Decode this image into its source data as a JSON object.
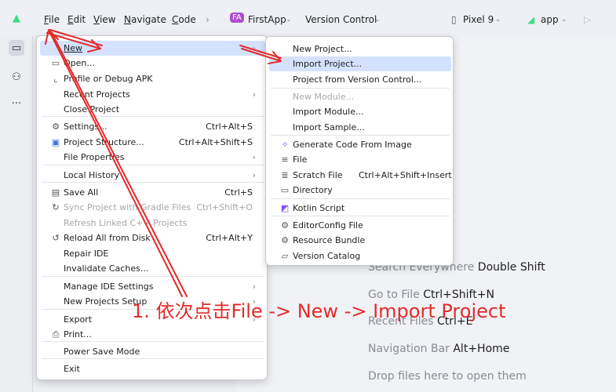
{
  "titlebar": {
    "menus": [
      "File",
      "Edit",
      "View",
      "Navigate",
      "Code"
    ],
    "menu_mnemonics": [
      "F",
      "E",
      "V",
      "N",
      "C"
    ],
    "project_badge": "FA",
    "project_name": "FirstApp",
    "vcs": "Version Control",
    "device": "Pixel 9",
    "run_config": "app"
  },
  "file_menu": {
    "items": [
      {
        "label": "New",
        "shortcut": "",
        "submenu": true,
        "highlighted": true,
        "disabled": false,
        "icon": ""
      },
      {
        "label": "Open...",
        "shortcut": "",
        "submenu": false,
        "disabled": false,
        "icon": "folder-icon"
      },
      {
        "label": "Profile or Debug APK",
        "shortcut": "",
        "submenu": false,
        "disabled": false,
        "icon": "profile-icon"
      },
      {
        "label": "Recent Projects",
        "shortcut": "",
        "submenu": true,
        "disabled": false,
        "icon": ""
      },
      {
        "label": "Close Project",
        "shortcut": "",
        "submenu": false,
        "disabled": false,
        "icon": ""
      },
      {
        "label": "Settings...",
        "shortcut": "Ctrl+Alt+S",
        "submenu": false,
        "disabled": false,
        "icon": "gear-icon"
      },
      {
        "label": "Project Structure...",
        "shortcut": "Ctrl+Alt+Shift+S",
        "submenu": false,
        "disabled": false,
        "icon": "project-structure-icon"
      },
      {
        "label": "File Properties",
        "shortcut": "",
        "submenu": true,
        "disabled": false,
        "icon": ""
      },
      {
        "label": "Local History",
        "shortcut": "",
        "submenu": true,
        "disabled": false,
        "icon": ""
      },
      {
        "label": "Save All",
        "shortcut": "Ctrl+S",
        "submenu": false,
        "disabled": false,
        "icon": "save-icon"
      },
      {
        "label": "Sync Project with Gradle Files",
        "shortcut": "Ctrl+Shift+O",
        "submenu": false,
        "disabled": true,
        "icon": "sync-icon"
      },
      {
        "label": "Refresh Linked C++ Projects",
        "shortcut": "",
        "submenu": false,
        "disabled": true,
        "icon": ""
      },
      {
        "label": "Reload All from Disk",
        "shortcut": "Ctrl+Alt+Y",
        "submenu": false,
        "disabled": false,
        "icon": "reload-icon"
      },
      {
        "label": "Repair IDE",
        "shortcut": "",
        "submenu": false,
        "disabled": false,
        "icon": ""
      },
      {
        "label": "Invalidate Caches...",
        "shortcut": "",
        "submenu": false,
        "disabled": false,
        "icon": ""
      },
      {
        "label": "Manage IDE Settings",
        "shortcut": "",
        "submenu": true,
        "disabled": false,
        "icon": ""
      },
      {
        "label": "New Projects Setup",
        "shortcut": "",
        "submenu": true,
        "disabled": false,
        "icon": ""
      },
      {
        "label": "Export",
        "shortcut": "",
        "submenu": true,
        "disabled": false,
        "icon": ""
      },
      {
        "label": "Print...",
        "shortcut": "",
        "submenu": false,
        "disabled": false,
        "icon": "print-icon"
      },
      {
        "label": "Power Save Mode",
        "shortcut": "",
        "submenu": false,
        "disabled": false,
        "icon": ""
      },
      {
        "label": "Exit",
        "shortcut": "",
        "submenu": false,
        "disabled": false,
        "icon": ""
      }
    ]
  },
  "new_submenu": {
    "items": [
      {
        "label": "New Project...",
        "shortcut": "",
        "highlighted": false,
        "disabled": false,
        "icon": ""
      },
      {
        "label": "Import Project...",
        "shortcut": "",
        "highlighted": true,
        "disabled": false,
        "icon": ""
      },
      {
        "label": "Project from Version Control...",
        "shortcut": "",
        "highlighted": false,
        "disabled": false,
        "icon": ""
      },
      {
        "label": "New Module...",
        "shortcut": "",
        "highlighted": false,
        "disabled": true,
        "icon": ""
      },
      {
        "label": "Import Module...",
        "shortcut": "",
        "highlighted": false,
        "disabled": false,
        "icon": ""
      },
      {
        "label": "Import Sample...",
        "shortcut": "",
        "highlighted": false,
        "disabled": false,
        "icon": ""
      },
      {
        "label": "Generate Code From Image",
        "shortcut": "",
        "highlighted": false,
        "disabled": false,
        "icon": "sparkle-icon"
      },
      {
        "label": "File",
        "shortcut": "",
        "highlighted": false,
        "disabled": false,
        "icon": "file-lines-icon"
      },
      {
        "label": "Scratch File",
        "shortcut": "Ctrl+Alt+Shift+Insert",
        "highlighted": false,
        "disabled": false,
        "icon": "scratch-file-icon"
      },
      {
        "label": "Directory",
        "shortcut": "",
        "highlighted": false,
        "disabled": false,
        "icon": "folder-icon"
      },
      {
        "label": "Kotlin Script",
        "shortcut": "",
        "highlighted": false,
        "disabled": false,
        "icon": "kotlin-icon"
      },
      {
        "label": "EditorConfig File",
        "shortcut": "",
        "highlighted": false,
        "disabled": false,
        "icon": "gear-icon"
      },
      {
        "label": "Resource Bundle",
        "shortcut": "",
        "highlighted": false,
        "disabled": false,
        "icon": "gear-icon"
      },
      {
        "label": "Version Catalog",
        "shortcut": "",
        "highlighted": false,
        "disabled": false,
        "icon": "catalog-icon"
      }
    ]
  },
  "editor_hints": [
    {
      "text": "Search Everywhere",
      "key": "Double Shift"
    },
    {
      "text": "Go to File",
      "key": "Ctrl+Shift+N"
    },
    {
      "text": "Recent Files",
      "key": "Ctrl+E"
    },
    {
      "text": "Navigation Bar",
      "key": "Alt+Home"
    },
    {
      "text": "Drop files here to open them",
      "key": ""
    }
  ],
  "annotation": {
    "text": "1. 依次点击File -> New -> Import Project",
    "color": "#e22b2b"
  },
  "colors": {
    "highlight": "#d4e2ff",
    "badge": "#b04fc9",
    "android": "#3ddc84"
  }
}
